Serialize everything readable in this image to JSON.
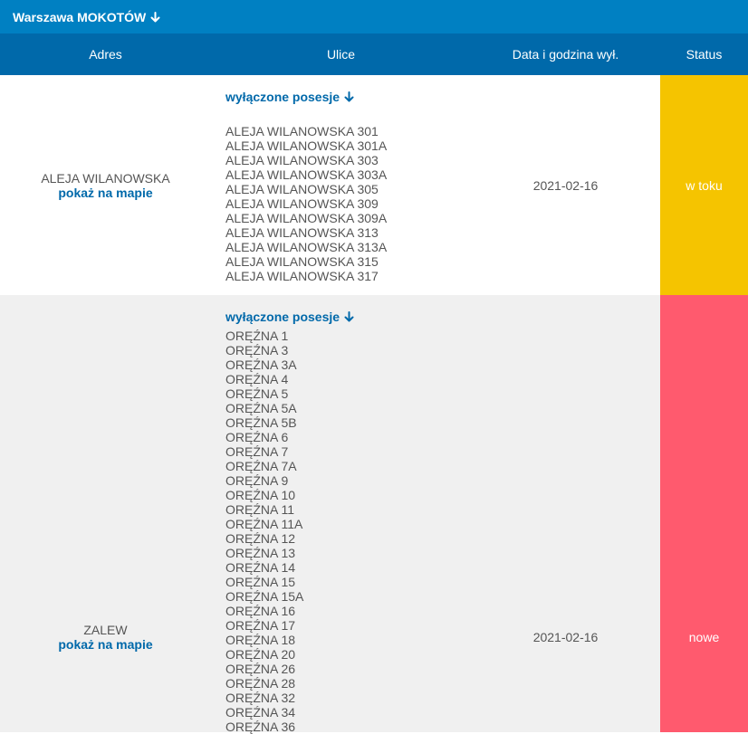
{
  "region": {
    "title": "Warszawa MOKOTÓW"
  },
  "columns": {
    "adres": "Adres",
    "ulice": "Ulice",
    "data": "Data i godzina wył.",
    "status": "Status"
  },
  "rows": [
    {
      "address": "ALEJA WILANOWSKA",
      "map_link": "pokaż na mapie",
      "toggle": "wyłączone posesje",
      "streets": [
        "ALEJA WILANOWSKA 301",
        "ALEJA WILANOWSKA 301A",
        "ALEJA WILANOWSKA 303",
        "ALEJA WILANOWSKA 303A",
        "ALEJA WILANOWSKA 305",
        "ALEJA WILANOWSKA 309",
        "ALEJA WILANOWSKA 309A",
        "ALEJA WILANOWSKA 313",
        "ALEJA WILANOWSKA 313A",
        "ALEJA WILANOWSKA 315",
        "ALEJA WILANOWSKA 317"
      ],
      "date": "2021-02-16",
      "status": "w toku",
      "status_color": "#f5c400"
    },
    {
      "address": "ZALEW",
      "map_link": "pokaż na mapie",
      "toggle": "wyłączone posesje",
      "streets": [
        "ORĘŹNA 1",
        "ORĘŹNA 3",
        "ORĘŹNA 3A",
        "ORĘŹNA 4",
        "ORĘŹNA 5",
        "ORĘŹNA 5A",
        "ORĘŹNA 5B",
        "ORĘŹNA 6",
        "ORĘŹNA 7",
        "ORĘŹNA 7A",
        "ORĘŹNA 9",
        "ORĘŹNA 10",
        "ORĘŹNA 11",
        "ORĘŹNA 11A",
        "ORĘŹNA 12",
        "ORĘŹNA 13",
        "ORĘŹNA 14",
        "ORĘŹNA 15",
        "ORĘŹNA 15A",
        "ORĘŹNA 16",
        "ORĘŹNA 17",
        "ORĘŹNA 18",
        "ORĘŹNA 20",
        "ORĘŹNA 26",
        "ORĘŹNA 28",
        "ORĘŹNA 32",
        "ORĘŹNA 34",
        "ORĘŹNA 36"
      ],
      "date": "2021-02-16",
      "status": "nowe",
      "status_color": "#ff5a6e"
    }
  ],
  "icons": {
    "expand": "arrow-down-icon"
  }
}
